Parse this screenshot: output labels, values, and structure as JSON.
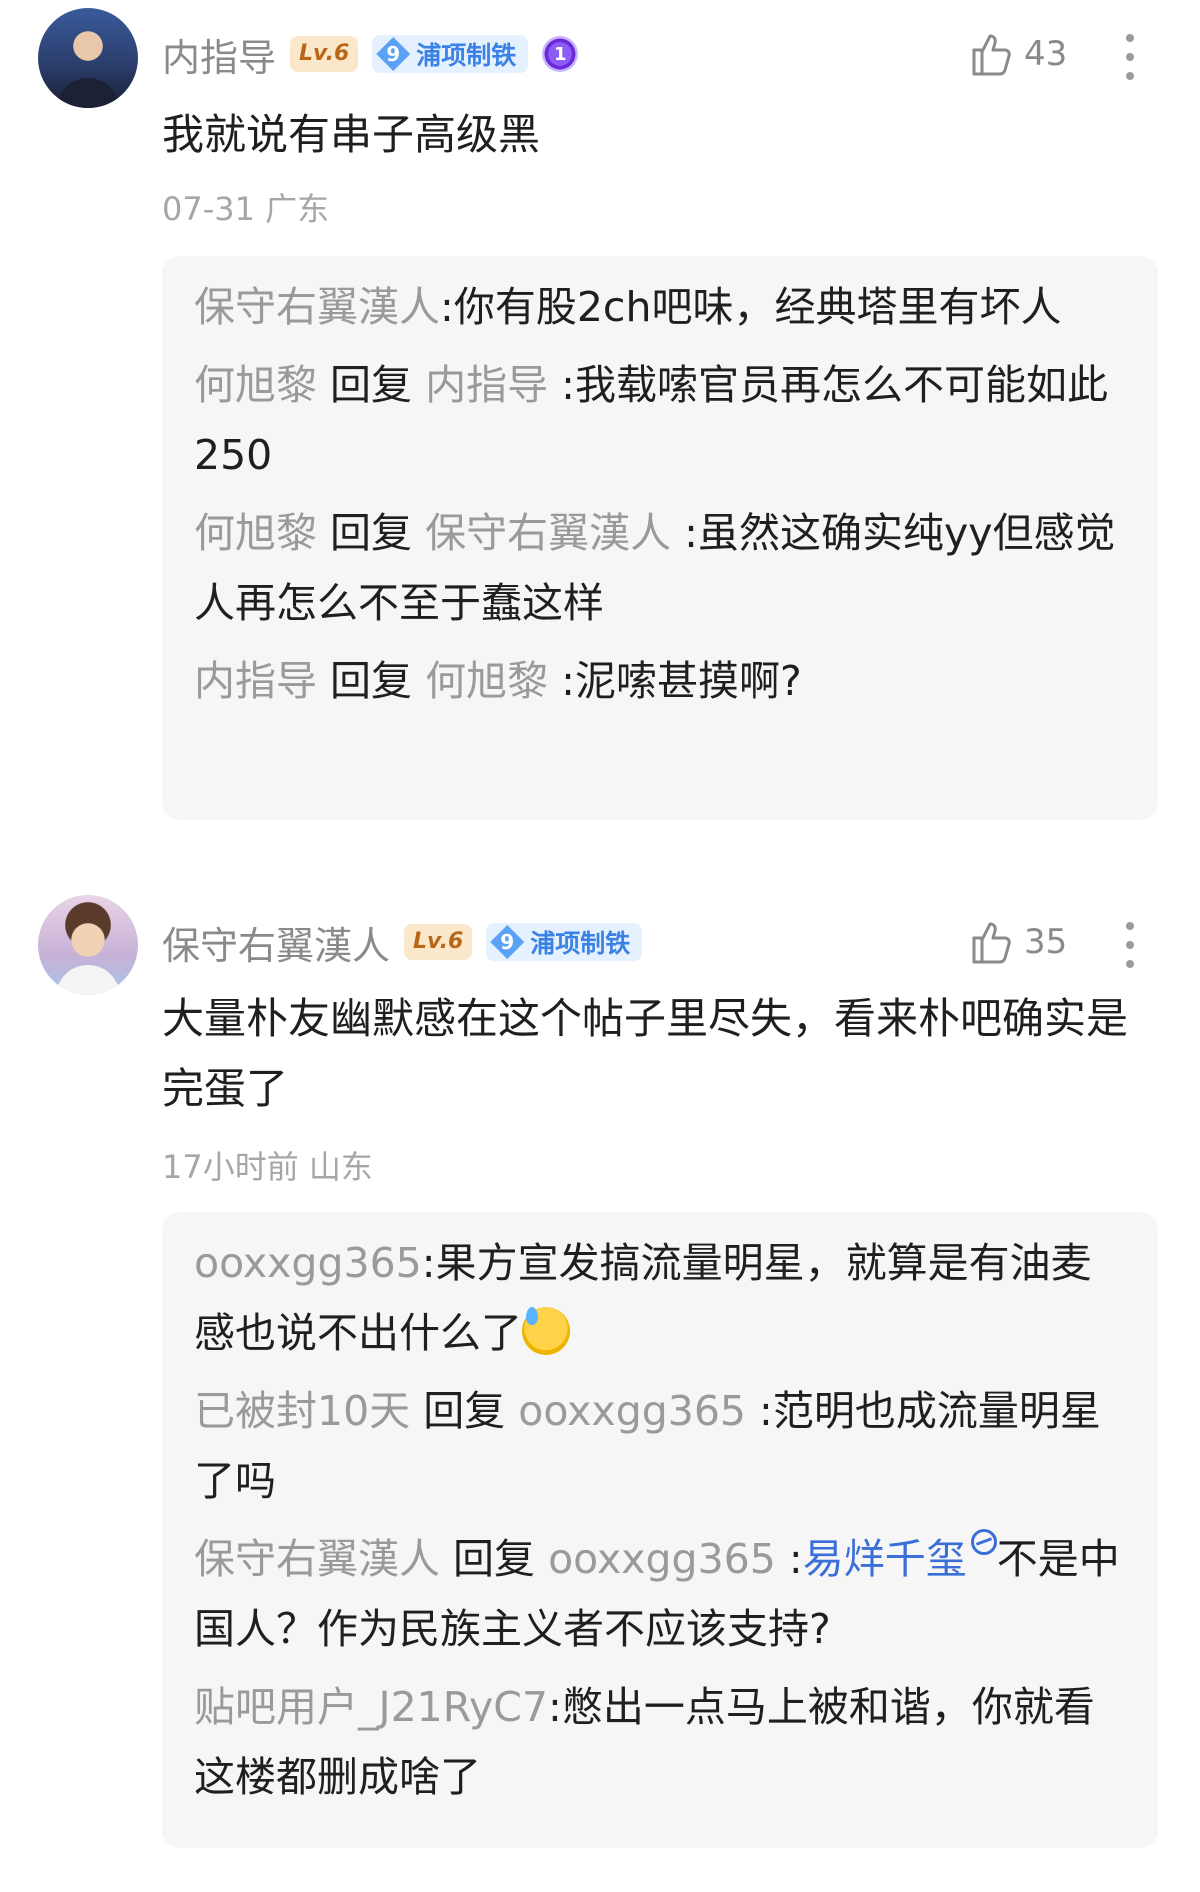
{
  "comments": [
    {
      "username": "内指导",
      "level": "Lv.6",
      "tag_num": "9",
      "tag_text": "浦项制铁",
      "medal": "1",
      "likes": "43",
      "text": "我就说有串子高级黑",
      "meta": "07-31 广东",
      "replies": [
        {
          "from": "保守右翼漢人",
          "sep": ":",
          "text": "你有股2ch吧味，经典塔里有坏人"
        },
        {
          "from": "何旭黎",
          "reply_word": "回复",
          "to": "内指导",
          "sep": " :",
          "text": "我载嗦官员再怎么不可能如此250"
        },
        {
          "from": "何旭黎",
          "reply_word": "回复",
          "to": "保守右翼漢人",
          "sep": " :",
          "text": "虽然这确实纯yy但感觉人再怎么不至于蠢这样"
        },
        {
          "from": "内指导",
          "reply_word": "回复",
          "to": "何旭黎",
          "sep": " :",
          "text": "泥嗦甚摸啊?"
        }
      ]
    },
    {
      "username": "保守右翼漢人",
      "level": "Lv.6",
      "tag_num": "9",
      "tag_text": "浦项制铁",
      "likes": "35",
      "text": "大量朴友幽默感在这个帖子里尽失，看来朴吧确实是完蛋了",
      "meta": "17小时前 山东",
      "replies": [
        {
          "from": "ooxxgg365",
          "sep": ":",
          "text": "果方宣发搞流量明星，就算是有油麦感也说不出什么了"
        },
        {
          "from": "已被封10天",
          "reply_word": "回复",
          "to": "ooxxgg365",
          "sep": " :",
          "text": "范明也成流量明星了吗"
        },
        {
          "from": "保守右翼漢人",
          "reply_word": "回复",
          "to": "ooxxgg365",
          "sep": " :",
          "link": "易烊千玺",
          "text": "不是中国人？作为民族主义者不应该支持?"
        },
        {
          "from": "贴吧用户_J21RyC7",
          "sep": ":",
          "text": "憋出一点马上被和谐，你就看这楼都删成啥了"
        }
      ]
    }
  ]
}
